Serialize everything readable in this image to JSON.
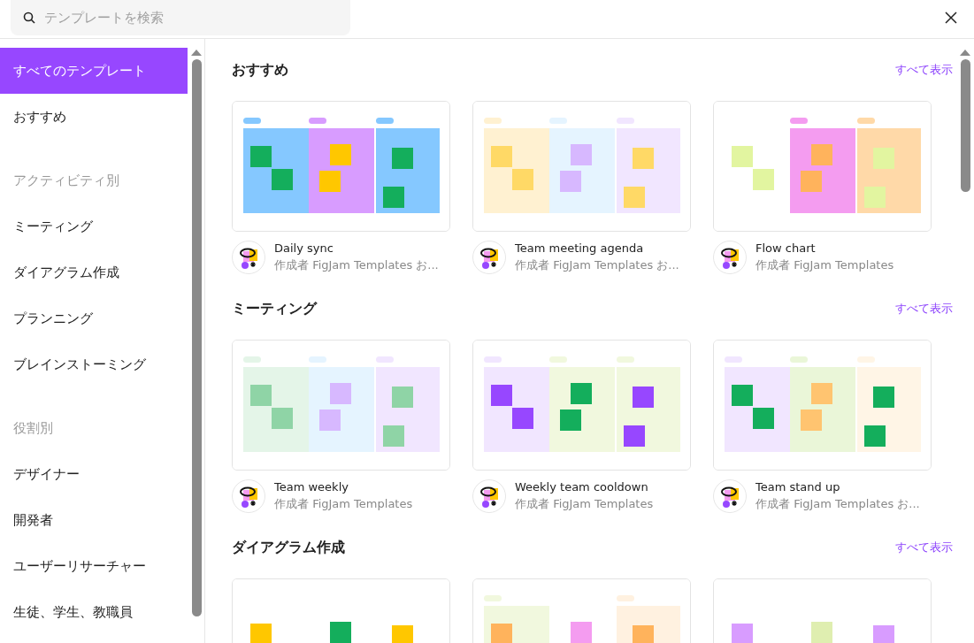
{
  "search": {
    "placeholder": "テンプレートを検索"
  },
  "sidebar": {
    "items": [
      {
        "kind": "item",
        "label": "すべてのテンプレート",
        "selected": true
      },
      {
        "kind": "item",
        "label": "おすすめ",
        "selected": false
      },
      {
        "kind": "heading",
        "label": "アクティビティ別"
      },
      {
        "kind": "item",
        "label": "ミーティング",
        "selected": false
      },
      {
        "kind": "item",
        "label": "ダイアグラム作成",
        "selected": false
      },
      {
        "kind": "item",
        "label": "プランニング",
        "selected": false
      },
      {
        "kind": "item",
        "label": "ブレインストーミング",
        "selected": false
      },
      {
        "kind": "heading",
        "label": "役割別"
      },
      {
        "kind": "item",
        "label": "デザイナー",
        "selected": false
      },
      {
        "kind": "item",
        "label": "開発者",
        "selected": false
      },
      {
        "kind": "item",
        "label": "ユーザーリサーチャー",
        "selected": false
      },
      {
        "kind": "item",
        "label": "生徒、学生、教職員",
        "selected": false
      }
    ]
  },
  "sections": [
    {
      "title": "おすすめ",
      "link": "すべて表示",
      "cards": [
        {
          "kind": "picture",
          "title": "Daily sync",
          "author": "作成者 FigJam Templates お..."
        },
        {
          "kind": "picture",
          "title": "Team meeting agenda",
          "author": "作成者 FigJam Templates お..."
        },
        {
          "kind": "picture",
          "title": "Flow chart",
          "author": "作成者 FigJam Templates"
        }
      ]
    },
    {
      "title": "ミーティング",
      "link": "すべて表示",
      "cards": [
        {
          "kind": "picture",
          "title": "Team weekly",
          "author": "作成者 FigJam Templates"
        },
        {
          "kind": "picture",
          "title": "Weekly team cooldown",
          "author": "作成者 FigJam Templates"
        },
        {
          "kind": "picture",
          "title": "Team stand up",
          "author": "作成者 FigJam Templates お..."
        }
      ]
    },
    {
      "title": "ダイアグラム作成",
      "link": "すべて表示"
    }
  ]
}
